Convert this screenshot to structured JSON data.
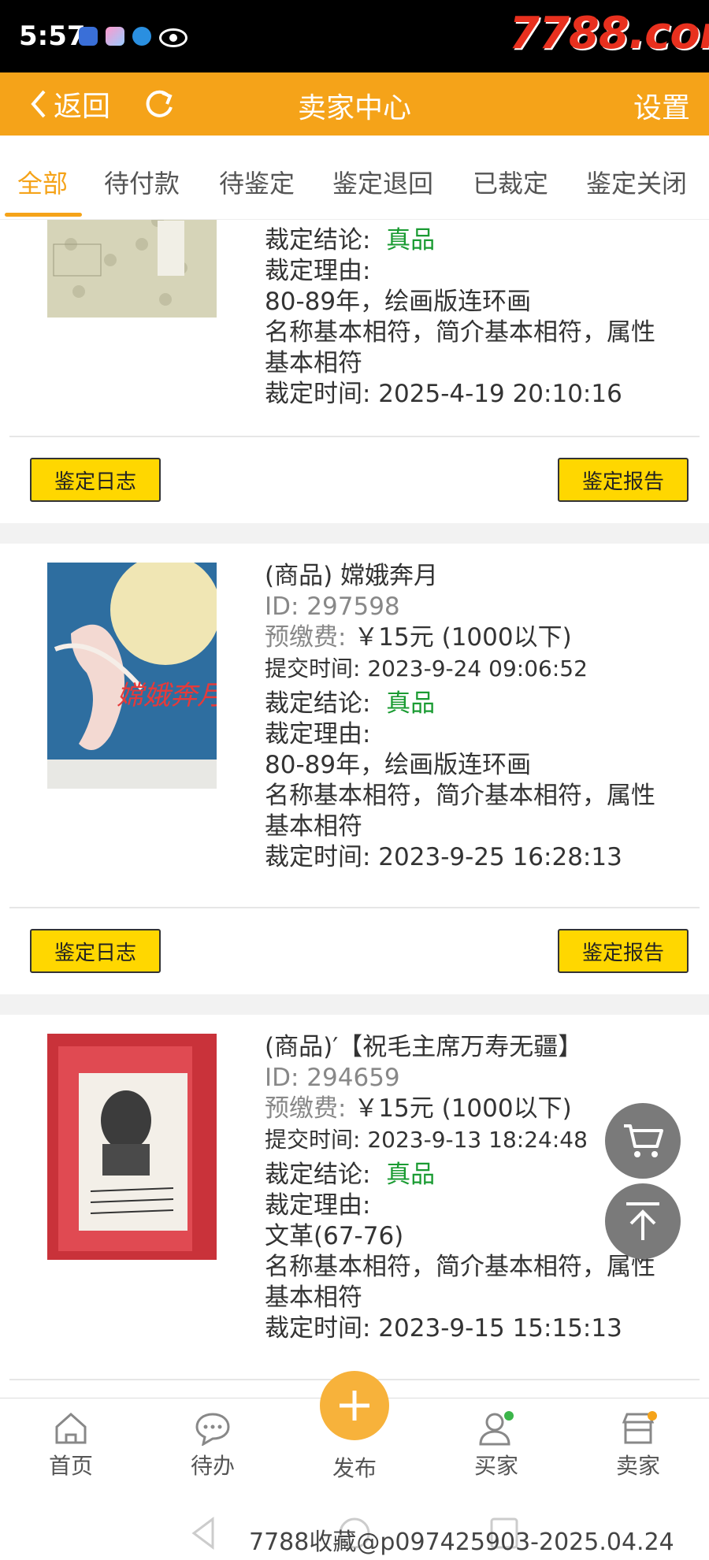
{
  "status": {
    "time": "5:57",
    "watermark": "7788.com"
  },
  "header": {
    "back_label": "返回",
    "title": "卖家中心",
    "settings_label": "设置"
  },
  "tabs": [
    {
      "label": "全部",
      "active": true
    },
    {
      "label": "待付款"
    },
    {
      "label": "待鉴定"
    },
    {
      "label": "鉴定退回"
    },
    {
      "label": "已裁定"
    },
    {
      "label": "鉴定关闭"
    }
  ],
  "items": [
    {
      "conclusion_label": "裁定结论:",
      "conclusion_value": "真品",
      "reason_label": "裁定理由:",
      "reason_lines": [
        "80-89年，绘画版连环画",
        "名称基本相符，简介基本相符，属性",
        "基本相符"
      ],
      "ruling_time": "裁定时间:  2025-4-19 20:10:16",
      "log_button": "鉴定日志",
      "report_button": "鉴定报告"
    },
    {
      "name": "(商品) 嫦娥奔月",
      "id": "ID: 297598",
      "fee_label": "预缴费:",
      "fee_value": "￥15元 (1000以下)",
      "submit_time": "提交时间:  2023-9-24 09:06:52",
      "conclusion_label": "裁定结论:",
      "conclusion_value": "真品",
      "reason_label": "裁定理由:",
      "reason_lines": [
        "80-89年，绘画版连环画",
        "名称基本相符，简介基本相符，属性",
        "基本相符"
      ],
      "ruling_time": "裁定时间:  2023-9-25 16:28:13",
      "log_button": "鉴定日志",
      "report_button": "鉴定报告"
    },
    {
      "name": "(商品)′【祝毛主席万寿无疆】",
      "id": "ID: 294659",
      "fee_label": "预缴费:",
      "fee_value": "￥15元 (1000以下)",
      "submit_time": "提交时间:  2023-9-13 18:24:48",
      "conclusion_label": "裁定结论:",
      "conclusion_value": "真品",
      "reason_label": "裁定理由:",
      "reason_lines": [
        "文革(67-76)",
        "名称基本相符，简介基本相符，属性",
        "基本相符"
      ],
      "ruling_time": "裁定时间:  2023-9-15 15:15:13"
    }
  ],
  "bottom_nav": {
    "home": "首页",
    "todo": "待办",
    "publish": "发布",
    "buyer": "买家",
    "seller": "卖家"
  },
  "footer_watermark": "7788收藏@p097425903-2025.04.24",
  "colors": {
    "accent": "#f5a319",
    "button": "#ffd700",
    "verdict": "#1a9b32"
  }
}
